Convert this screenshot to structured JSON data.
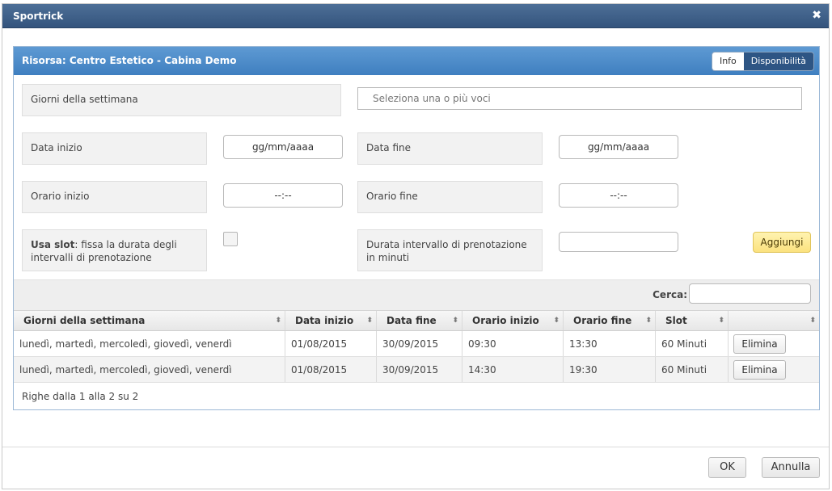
{
  "window": {
    "title": "Sportrick",
    "close_glyph": "✖"
  },
  "panel": {
    "title": "Risorsa: Centro Estetico - Cabina Demo",
    "tabs": [
      {
        "label": "Info",
        "active": false
      },
      {
        "label": "Disponibilità",
        "active": true
      }
    ]
  },
  "form": {
    "days_label": "Giorni della settimana",
    "days_placeholder": "Seleziona una o più voci",
    "start_date_label": "Data inizio",
    "start_date_value": "gg/mm/aaaa",
    "end_date_label": "Data fine",
    "end_date_value": "gg/mm/aaaa",
    "start_time_label": "Orario inizio",
    "start_time_value": "--:--",
    "end_time_label": "Orario fine",
    "end_time_value": "--:--",
    "use_slot_bold": "Usa slot",
    "use_slot_rest": ": fissa la durata degli intervalli di prenotazione",
    "interval_label": "Durata intervallo di prenotazione in minuti",
    "interval_value": "",
    "add_button": "Aggiungi"
  },
  "search": {
    "label": "Cerca:",
    "value": ""
  },
  "table": {
    "columns": [
      "Giorni della settimana",
      "Data inizio",
      "Data fine",
      "Orario inizio",
      "Orario fine",
      "Slot",
      ""
    ],
    "sort_glyph": "⬍",
    "rows": [
      {
        "days": "lunedì, martedì, mercoledì, giovedì, venerdì",
        "start_date": "01/08/2015",
        "end_date": "30/09/2015",
        "start_time": "09:30",
        "end_time": "13:30",
        "slot": "60 Minuti",
        "action": "Elimina"
      },
      {
        "days": "lunedì, martedì, mercoledì, giovedì, venerdì",
        "start_date": "01/08/2015",
        "end_date": "30/09/2015",
        "start_time": "14:30",
        "end_time": "19:30",
        "slot": "60 Minuti",
        "action": "Elimina"
      }
    ],
    "info": "Righe dalla 1 alla 2 su 2"
  },
  "footer": {
    "ok": "OK",
    "cancel": "Annulla"
  },
  "colors": {
    "titlebar": "#34547d",
    "panel_header": "#3f7fc0",
    "active_tab": "#2e5584",
    "add_button": "#fbe27f"
  }
}
